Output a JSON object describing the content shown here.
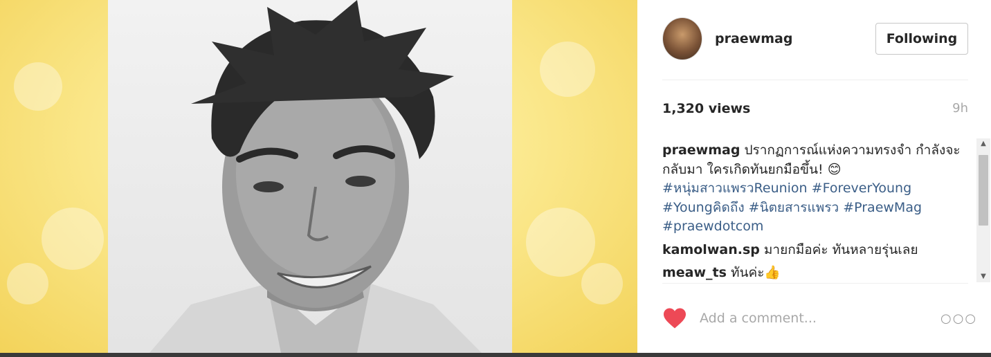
{
  "post": {
    "username": "praewmag",
    "follow_label": "Following",
    "views": "1,320 views",
    "time_ago": "9h"
  },
  "caption": {
    "username": "praewmag",
    "text": "ปรากฏการณ์แห่งความทรงจำ กำลังจะกลับมา ใครเกิดทันยกมือขึ้น! 😊",
    "hashtags": [
      "#หนุ่มสาวแพรวReunion",
      "#ForeverYoung",
      "#Youngคิดถึง",
      "#นิตยสารแพรว",
      "#PraewMag",
      "#praewdotcom"
    ]
  },
  "comments": [
    {
      "username": "kamolwan.sp",
      "text": "มายกมือค่ะ ทันหลายรุ่นเลย"
    },
    {
      "username": "meaw_ts",
      "text": "ทันค่ะ👍"
    }
  ],
  "comment_box": {
    "placeholder": "Add a comment..."
  },
  "icons": {
    "like": "heart-icon",
    "more": "more-options-icon",
    "avatar": "avatar",
    "scroll_up": "scroll-up-arrow-icon",
    "scroll_down": "scroll-down-arrow-icon"
  },
  "colors": {
    "heart": "#ed4956",
    "hashtag": "#3b5e87",
    "background_left": "#f3d35a"
  }
}
